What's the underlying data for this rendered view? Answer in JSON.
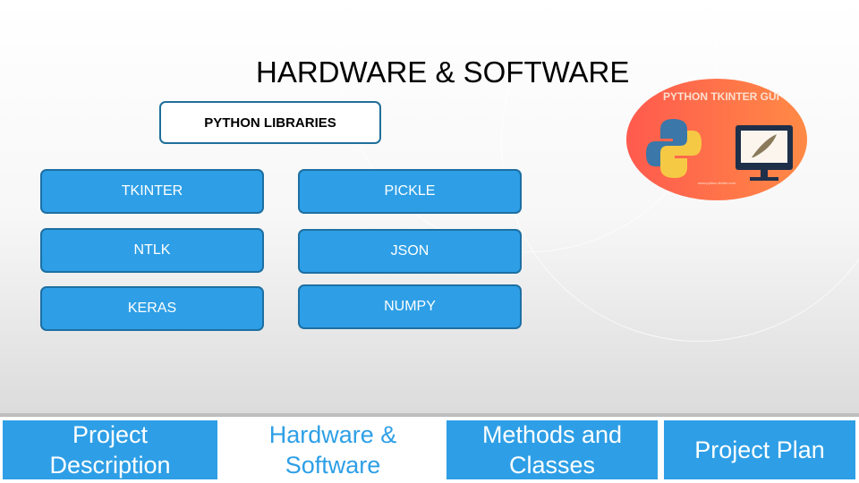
{
  "slide": {
    "title": "HARDWARE & SOFTWARE",
    "libraries_header": "PYTHON LIBRARIES",
    "libraries": [
      {
        "label": "TKINTER"
      },
      {
        "label": "PICKLE"
      },
      {
        "label": "NTLK"
      },
      {
        "label": "JSON"
      },
      {
        "label": "KERAS"
      },
      {
        "label": "NUMPY"
      }
    ],
    "logo": {
      "caption": "PYTHON TKINTER GUI",
      "footer_text": "www.python-tkinter.com"
    }
  },
  "footer_nav": [
    {
      "label": "Project\nDescription",
      "style": "active"
    },
    {
      "label": "Hardware &\nSoftware",
      "style": "inactive"
    },
    {
      "label": "Methods and\nClasses",
      "style": "active"
    },
    {
      "label": "Project Plan",
      "style": "active"
    }
  ],
  "colors": {
    "accent": "#2e9fe6",
    "border": "#1d6fa3",
    "logo_bg_start": "#ff5a4e",
    "logo_bg_end": "#ff8a45"
  }
}
